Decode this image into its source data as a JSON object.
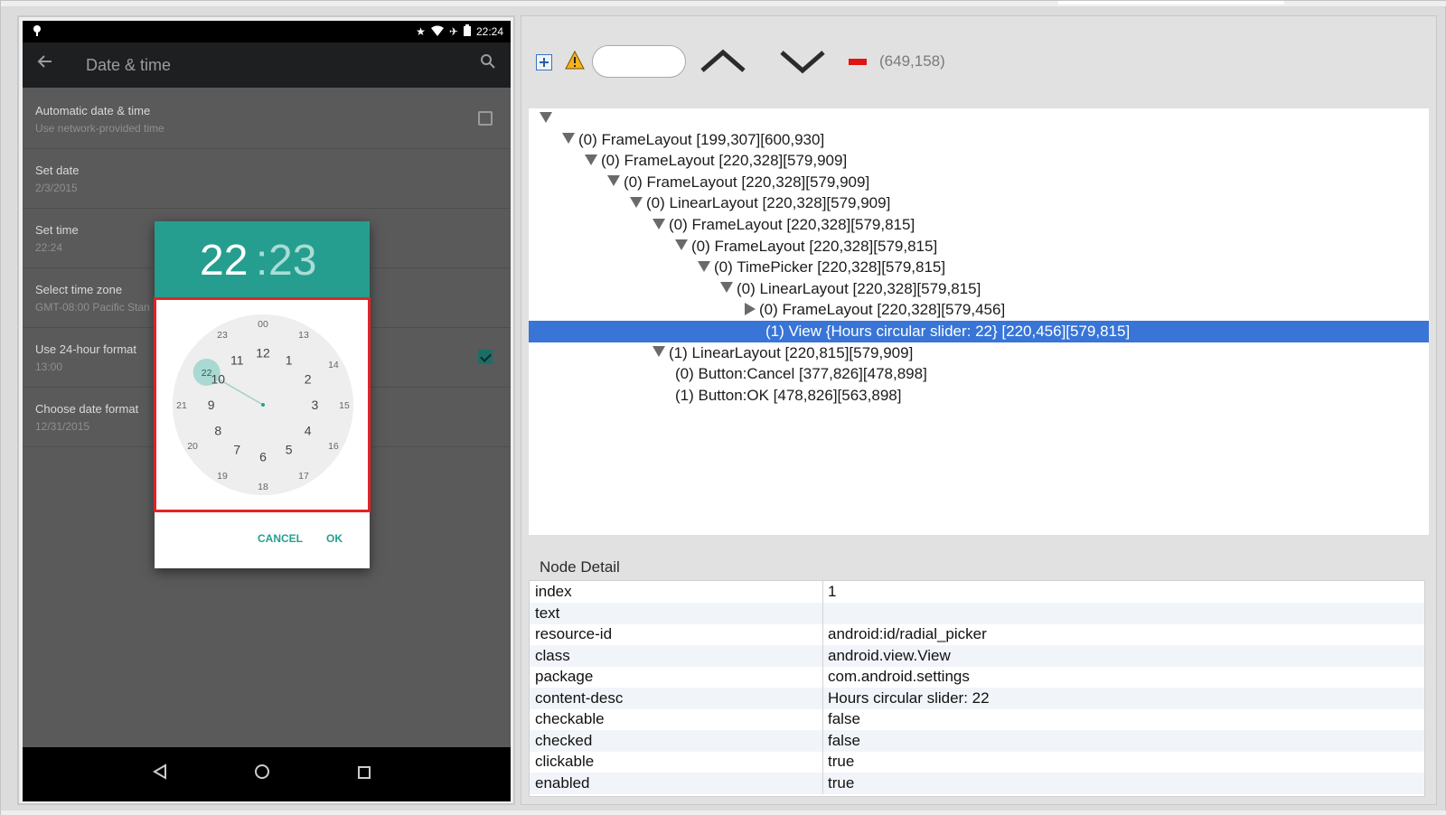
{
  "device": {
    "status_time": "22:24",
    "app_title": "Date & time",
    "prefs": [
      {
        "title": "Automatic date & time",
        "summary": "Use network-provided time",
        "checkbox": "off"
      },
      {
        "title": "Set date",
        "summary": "2/3/2015"
      },
      {
        "title": "Set time",
        "summary": "22:24"
      },
      {
        "title": "Select time zone",
        "summary": "GMT-08:00 Pacific Stan"
      },
      {
        "title": "Use 24-hour format",
        "summary": "13:00",
        "checkbox": "on"
      },
      {
        "title": "Choose date format",
        "summary": "12/31/2015"
      }
    ],
    "dialog": {
      "hours": "22",
      "colon": ":",
      "minutes": "23",
      "selected_hour": "22",
      "outer_numbers": [
        "12",
        "1",
        "2",
        "3",
        "4",
        "5",
        "6",
        "7",
        "8",
        "9",
        "10",
        "11"
      ],
      "inner_numbers": [
        "00",
        "13",
        "14",
        "15",
        "16",
        "17",
        "18",
        "19",
        "20",
        "21",
        "22",
        "23"
      ],
      "cancel": "CANCEL",
      "ok": "OK"
    }
  },
  "toolbar": {
    "coords": "(649,158)"
  },
  "tree": [
    {
      "depth": 0,
      "toggle": "down",
      "label": ""
    },
    {
      "depth": 1,
      "toggle": "down",
      "label": "(0) FrameLayout [199,307][600,930]"
    },
    {
      "depth": 2,
      "toggle": "down",
      "label": "(0) FrameLayout [220,328][579,909]"
    },
    {
      "depth": 3,
      "toggle": "down",
      "label": "(0) FrameLayout [220,328][579,909]"
    },
    {
      "depth": 4,
      "toggle": "down",
      "label": "(0) LinearLayout [220,328][579,909]"
    },
    {
      "depth": 5,
      "toggle": "down",
      "label": "(0) FrameLayout [220,328][579,815]"
    },
    {
      "depth": 6,
      "toggle": "down",
      "label": "(0) FrameLayout [220,328][579,815]"
    },
    {
      "depth": 7,
      "toggle": "down",
      "label": "(0) TimePicker [220,328][579,815]"
    },
    {
      "depth": 8,
      "toggle": "down",
      "label": "(0) LinearLayout [220,328][579,815]"
    },
    {
      "depth": 9,
      "toggle": "right",
      "label": "(0) FrameLayout [220,328][579,456]"
    },
    {
      "depth": 10,
      "toggle": "none",
      "label": "(1) View {Hours circular slider: 22} [220,456][579,815]",
      "selected": true
    },
    {
      "depth": 5,
      "toggle": "down",
      "label": "(1) LinearLayout [220,815][579,909]"
    },
    {
      "depth": 6,
      "toggle": "none",
      "label": "(0) Button:Cancel [377,826][478,898]"
    },
    {
      "depth": 6,
      "toggle": "none",
      "label": "(1) Button:OK [478,826][563,898]"
    }
  ],
  "node_detail": {
    "title": "Node Detail",
    "rows": [
      {
        "key": "index",
        "value": "1"
      },
      {
        "key": "text",
        "value": ""
      },
      {
        "key": "resource-id",
        "value": "android:id/radial_picker"
      },
      {
        "key": "class",
        "value": "android.view.View"
      },
      {
        "key": "package",
        "value": "com.android.settings"
      },
      {
        "key": "content-desc",
        "value": "Hours circular slider: 22"
      },
      {
        "key": "checkable",
        "value": "false"
      },
      {
        "key": "checked",
        "value": "false"
      },
      {
        "key": "clickable",
        "value": "true"
      },
      {
        "key": "enabled",
        "value": "true"
      }
    ]
  },
  "colors": {
    "accent": "#269e8f",
    "selection": "#3875d7",
    "highlight_border": "#e12424"
  }
}
